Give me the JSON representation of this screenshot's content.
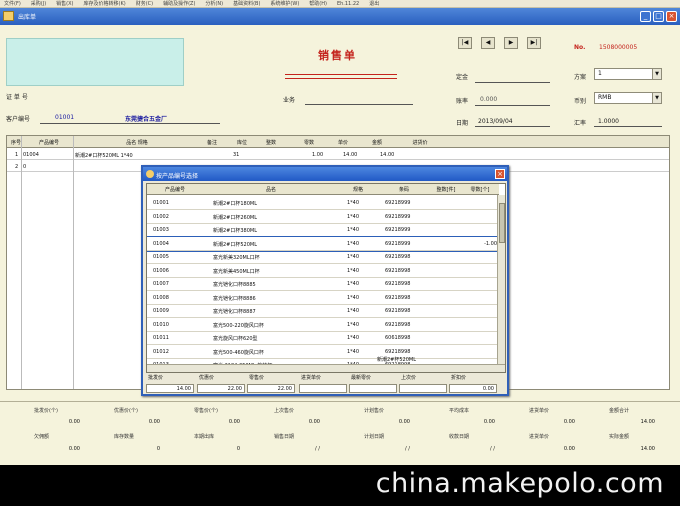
{
  "menu": [
    "文件(F)",
    "采购(J)",
    "销售(X)",
    "库存及价格转移(K)",
    "财务(C)",
    "辅助及操作(Z)",
    "分析(N)",
    "基础资料(B)",
    "系统维护(W)",
    "帮助(H)",
    "Eh.11.22",
    "退出"
  ],
  "window": {
    "title": "出库单",
    "min": "_",
    "max": "□",
    "close": "×"
  },
  "header": {
    "form_title": "销售单",
    "nav_buttons": [
      "|◀",
      "◀",
      "▶",
      "▶|"
    ],
    "no_label": "No.",
    "no_value": "1508000005",
    "voucher_label": "证 单 号",
    "customer_label": "客户编号",
    "customer_code": "01001",
    "customer_name": "东莞捷合五金厂",
    "salesman_label": "业务",
    "terms_label": "定金",
    "discount_label": "账率",
    "discount_value": "0.000",
    "date_label": "日期",
    "date_value": "2013/09/04",
    "unit_label": "方案",
    "unit_value": "1",
    "currency_label": "币别",
    "currency_value": "RMB",
    "rate_label": "汇率",
    "rate_value": "1.0000"
  },
  "grid": {
    "columns": [
      "序号",
      "产品编号",
      "品名 规格",
      "备注",
      "库位",
      "整数",
      "零数",
      "单价",
      "金额",
      "进货价"
    ],
    "rows": [
      [
        "1",
        "01004",
        "新潮2#口杯520ML 1*40",
        "",
        "31",
        "",
        "1.00",
        "14.00",
        "14.00",
        ""
      ],
      [
        "2",
        "0",
        "",
        "",
        "",
        "",
        "",
        "",
        "",
        ""
      ]
    ]
  },
  "dialog": {
    "title": "按产品编号选择",
    "close": "×",
    "columns": [
      "产品编号",
      "品名",
      "规格",
      "条码",
      "整数[件]",
      "零数[个]"
    ],
    "rows": [
      [
        "01001",
        "新潮2#口杯180ML",
        "1*40",
        "69218999",
        "",
        ""
      ],
      [
        "01002",
        "新潮2#口杯260ML",
        "1*40",
        "69218999",
        "",
        ""
      ],
      [
        "01003",
        "新潮2#口杯380ML",
        "1*40",
        "69218999",
        "",
        ""
      ],
      [
        "01004",
        "新潮2#口杯520ML",
        "1*40",
        "69218999",
        "",
        "-1.00"
      ],
      [
        "01005",
        "富光新美320ML口杯",
        "1*40",
        "69218998",
        "",
        ""
      ],
      [
        "01006",
        "富光新美450ML口杯",
        "1*40",
        "69218998",
        "",
        ""
      ],
      [
        "01007",
        "富光铠化口杯8885",
        "1*40",
        "69218998",
        "",
        ""
      ],
      [
        "01008",
        "富光铠化口杯8886",
        "1*40",
        "69218998",
        "",
        ""
      ],
      [
        "01009",
        "富光铠化口杯8887",
        "1*40",
        "69218998",
        "",
        ""
      ],
      [
        "01010",
        "富光500-220旋风口杯",
        "1*40",
        "69218998",
        "",
        ""
      ],
      [
        "01011",
        "富光旋风口杯620型",
        "1*40",
        "60618998",
        "",
        ""
      ],
      [
        "01012",
        "富光500-460旋风口杯",
        "1*40",
        "69218998",
        "",
        ""
      ],
      [
        "01013",
        "富光 2184-350ML 旋转杯",
        "1*40",
        "69218998",
        "",
        ""
      ]
    ],
    "status_text": "新潮2#杯520ML",
    "footer": [
      {
        "label": "批发价",
        "value": "14.00"
      },
      {
        "label": "优惠价",
        "value": "22.00"
      },
      {
        "label": "零售价",
        "value": "22.00"
      },
      {
        "label": "进货单价",
        "value": ""
      },
      {
        "label": "最新零价",
        "value": ""
      },
      {
        "label": "上次价",
        "value": ""
      },
      {
        "label": "折扣价",
        "value": "0.00"
      }
    ]
  },
  "summary": {
    "row1": [
      {
        "label": "批发价(个)",
        "value": "0.00"
      },
      {
        "label": "优惠价(个)",
        "value": "0.00"
      },
      {
        "label": "零售价(个)",
        "value": "0.00"
      },
      {
        "label": "上次售价",
        "value": "0.00"
      },
      {
        "label": "计划售价",
        "value": "0.00"
      },
      {
        "label": "平均成本",
        "value": "0.00"
      },
      {
        "label": "进货单价",
        "value": "0.00"
      },
      {
        "label": "金额合计",
        "value": "14.00"
      }
    ],
    "row2": [
      {
        "label": "欠佣额",
        "value": "0.00"
      },
      {
        "label": "库存数量",
        "value": "0"
      },
      {
        "label": "本期出库",
        "value": "0"
      },
      {
        "label": "销售日期",
        "value": "/ /"
      },
      {
        "label": "计划日期",
        "value": "/ /"
      },
      {
        "label": "收款日期",
        "value": "/ /"
      },
      {
        "label": "进货单价",
        "value": "0.00"
      },
      {
        "label": "实际金额",
        "value": "14.00"
      }
    ]
  },
  "watermark": "china.makepolo.com"
}
